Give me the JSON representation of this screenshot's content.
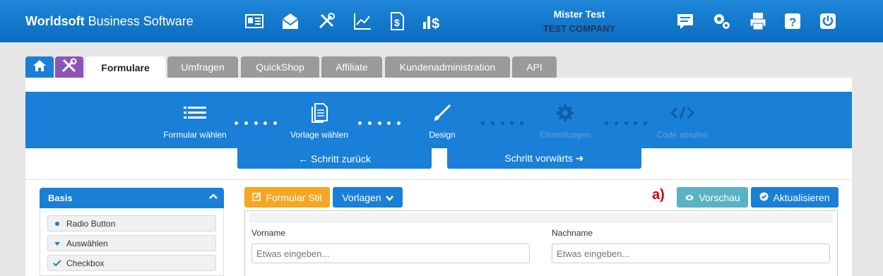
{
  "header": {
    "brand_bold": "Worldsoft",
    "brand_rest": " Business Software",
    "user_name": "Mister Test",
    "company": "TEST COMPANY",
    "left_icons": [
      "contact-card-icon",
      "mail-icon",
      "tools-icon",
      "chart-icon",
      "invoice-icon",
      "sales-icon"
    ],
    "right_icons": [
      "message-icon",
      "gears-icon",
      "printer-icon",
      "help-icon",
      "power-icon"
    ]
  },
  "tabs": [
    {
      "label": "Formulare",
      "active": true
    },
    {
      "label": "Umfragen",
      "active": false
    },
    {
      "label": "QuickShop",
      "active": false
    },
    {
      "label": "Affiliate",
      "active": false
    },
    {
      "label": "Kundenadministration",
      "active": false
    },
    {
      "label": "API",
      "active": false
    }
  ],
  "wizard": {
    "steps": [
      {
        "label": "Formular wählen",
        "icon": "list-icon",
        "enabled": true
      },
      {
        "label": "Vorlage wählen",
        "icon": "document-icon",
        "enabled": true
      },
      {
        "label": "Design",
        "icon": "brush-icon",
        "enabled": true
      },
      {
        "label": "Einstellungen",
        "icon": "gear-icon",
        "enabled": false
      },
      {
        "label": "Code abrufen",
        "icon": "code-icon",
        "enabled": false
      }
    ],
    "back_label": "← Schritt zurück",
    "forward_label": "Schritt vorwärts ➜"
  },
  "sidebar": {
    "title": "Basis",
    "items": [
      {
        "label": "Radio Button",
        "icon": "radio-dot-icon"
      },
      {
        "label": "Auswählen",
        "icon": "dropdown-icon"
      },
      {
        "label": "Checkbox",
        "icon": "checkmark-icon"
      }
    ]
  },
  "toolbar": {
    "stil_label": "Formular Stil",
    "vorlagen_label": "Vorlagen",
    "marker": "a)",
    "vorschau_label": "Vorschau",
    "aktualisieren_label": "Aktualisieren"
  },
  "form": {
    "first_label": "Vorname",
    "first_placeholder": "Etwas eingeben...",
    "last_label": "Nachname",
    "last_placeholder": "Etwas eingeben..."
  },
  "colors": {
    "header": "#1a7fd6",
    "wizard": "#1a7fd6",
    "stil_button": "#f5a623",
    "vorschau_button": "#5ab3c5",
    "tools_tab": "#8e55b8",
    "marker": "#d0021b"
  }
}
